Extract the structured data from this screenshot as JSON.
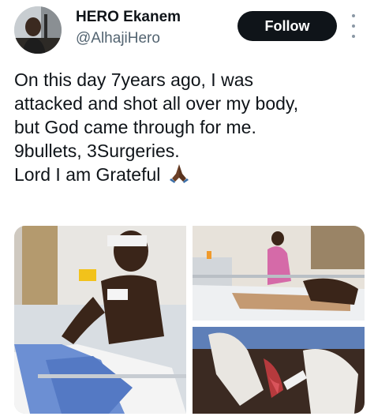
{
  "author": {
    "display_name": "HERO Ekanem",
    "handle": "@AlhajiHero",
    "avatar_icon": "profile-photo"
  },
  "actions": {
    "follow_label": "Follow",
    "more_icon": "vertical-ellipsis-icon"
  },
  "tweet": {
    "lines": [
      "On this day 7years ago, I was",
      "attacked and shot all over my body,",
      "but God came through for me.",
      "9bullets, 3Surgeries.",
      "Lord I am Grateful"
    ],
    "emoji_icon": "folded-hands-emoji"
  },
  "media": {
    "count": 3,
    "images": [
      "man-in-hospital-bed-photo",
      "nurse-at-bedside-photo",
      "wound-care-photo"
    ]
  },
  "colors": {
    "follow_bg": "#0f1419",
    "handle_text": "#536471",
    "text": "#0f1419"
  }
}
